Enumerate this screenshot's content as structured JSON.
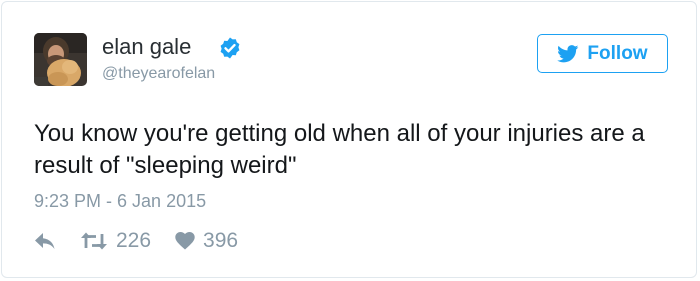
{
  "tweet": {
    "author_name": "elan gale",
    "author_handle": "@theyearofelan",
    "verified": true,
    "follow_label": "Follow",
    "text": "You know you're getting old when all of your injuries are a result of \"sleeping weird\"",
    "timestamp": "9:23 PM - 6 Jan 2015",
    "retweet_count": "226",
    "like_count": "396"
  },
  "colors": {
    "twitter_blue": "#1da1f2",
    "muted_gray": "#8899a6",
    "text_dark": "#14171a",
    "border": "#e1e8ed"
  },
  "icons": {
    "verified": "verified-badge-icon",
    "follow": "twitter-bird-icon",
    "reply": "reply-arrow-icon",
    "retweet": "retweet-icon",
    "like": "heart-icon"
  }
}
